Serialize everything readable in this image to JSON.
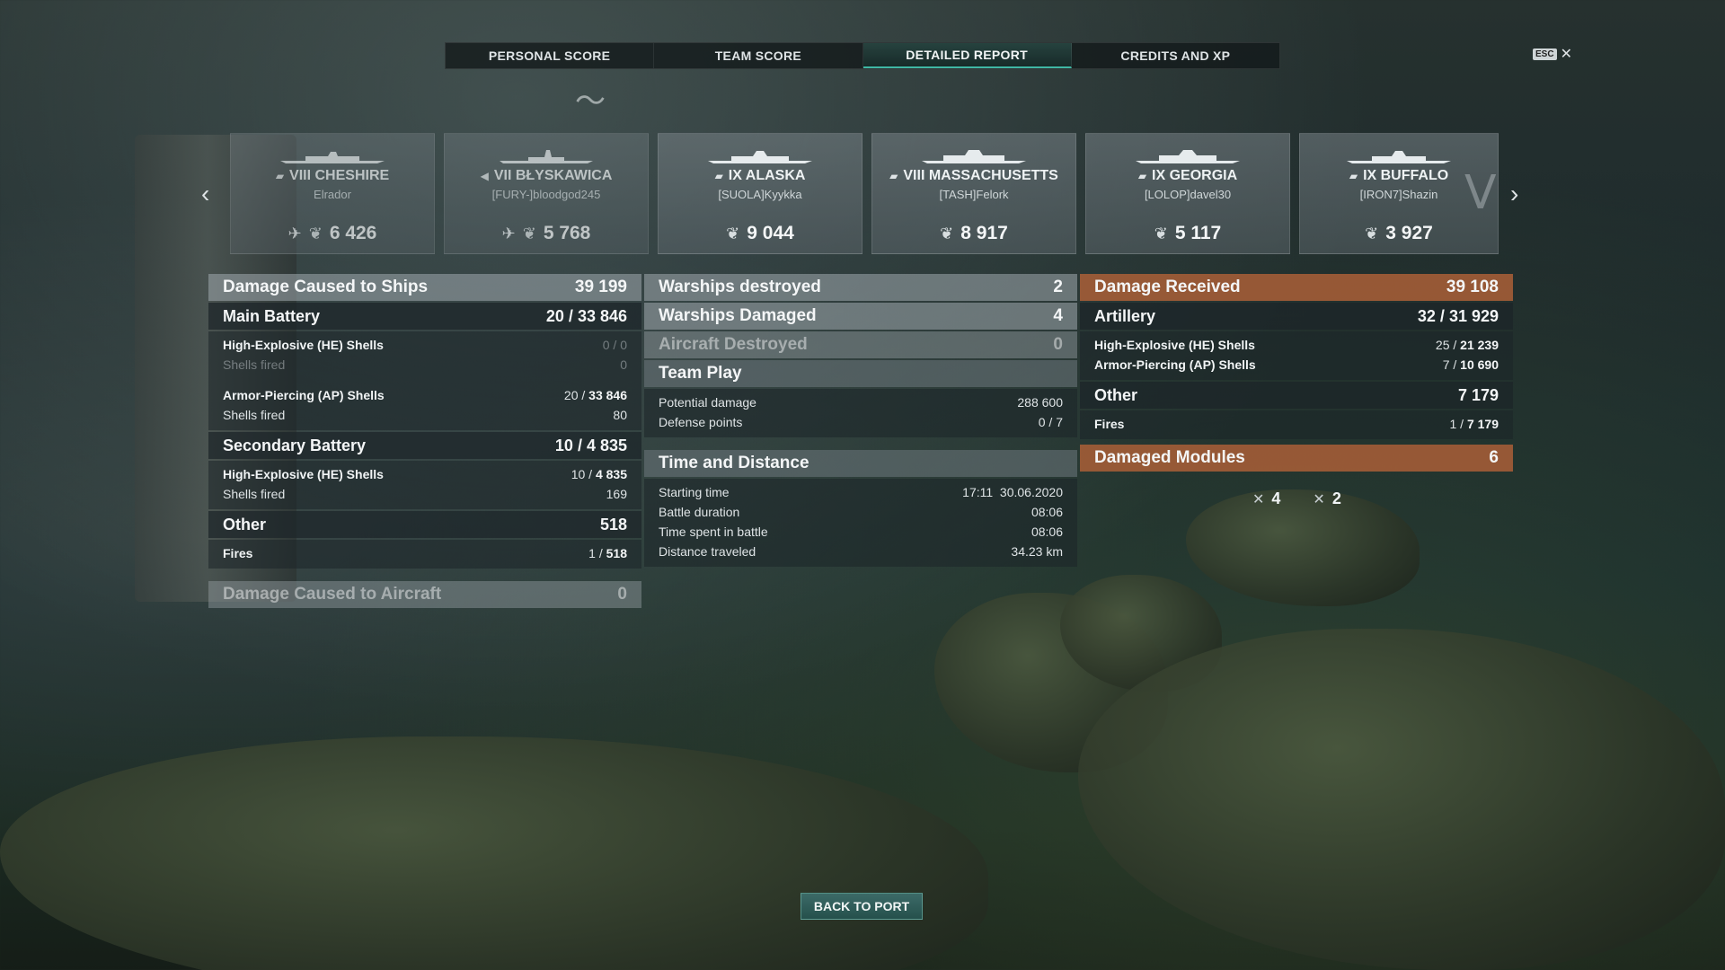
{
  "tabs": [
    {
      "label": "PERSONAL SCORE"
    },
    {
      "label": "TEAM SCORE"
    },
    {
      "label": "DETAILED REPORT"
    },
    {
      "label": "CREDITS AND XP"
    }
  ],
  "esc": {
    "key": "ESC",
    "close": "✕"
  },
  "nav": {
    "prev": "‹",
    "next": "›"
  },
  "ships": [
    {
      "tier_class": "▰",
      "name": "VIII CHESHIRE",
      "player": "Elrador",
      "score": "6 426",
      "has_plane": true
    },
    {
      "tier_class": "◀",
      "name": "VII BŁYSKAWICA",
      "player": "[FURY-]bloodgod245",
      "score": "5 768",
      "has_plane": true
    },
    {
      "tier_class": "▰",
      "name": "IX ALASKA",
      "player": "[SUOLA]Kyykka",
      "score": "9 044",
      "has_plane": false
    },
    {
      "tier_class": "▰",
      "name": "VIII MASSACHUSETTS",
      "player": "[TASH]Felork",
      "score": "8 917",
      "has_plane": false
    },
    {
      "tier_class": "▰",
      "name": "IX GEORGIA",
      "player": "[LOLOP]davel30",
      "score": "5 117",
      "has_plane": false
    },
    {
      "tier_class": "▰",
      "name": "IX BUFFALO",
      "player": "[IRON7]Shazin",
      "score": "3 927",
      "has_plane": false
    }
  ],
  "left": {
    "damage_ships": {
      "label": "Damage Caused to Ships",
      "value": "39 199"
    },
    "main_battery": {
      "label": "Main Battery",
      "value_a": "20",
      "value_b": "33 846"
    },
    "he_main": {
      "label": "High-Explosive (HE) Shells",
      "value": "0 / 0"
    },
    "he_main_fired": {
      "label": "Shells fired",
      "value": "0"
    },
    "ap_main": {
      "label": "Armor-Piercing (AP) Shells",
      "value_a": "20 / ",
      "value_b": "33 846"
    },
    "ap_main_fired": {
      "label": "Shells fired",
      "value": "80"
    },
    "secondary": {
      "label": "Secondary Battery",
      "value_a": "10",
      "value_b": "4 835"
    },
    "he_sec": {
      "label": "High-Explosive (HE) Shells",
      "value_a": "10 / ",
      "value_b": "4 835"
    },
    "he_sec_fired": {
      "label": "Shells fired",
      "value": "169"
    },
    "other": {
      "label": "Other",
      "value": "518"
    },
    "fires": {
      "label": "Fires",
      "value_a": "1 / ",
      "value_b": "518"
    },
    "damage_aircraft": {
      "label": "Damage Caused to Aircraft",
      "value": "0"
    }
  },
  "middle": {
    "destroyed": {
      "label": "Warships destroyed",
      "value": "2"
    },
    "damaged": {
      "label": "Warships Damaged",
      "value": "4"
    },
    "aircraft": {
      "label": "Aircraft Destroyed",
      "value": "0"
    },
    "team_play": {
      "label": "Team Play"
    },
    "potential": {
      "label": "Potential damage",
      "value": "288 600"
    },
    "defense": {
      "label": "Defense points",
      "value": "0 / 7"
    },
    "time_distance": {
      "label": "Time and Distance"
    },
    "start": {
      "label": "Starting time",
      "value": "17:11  30.06.2020"
    },
    "duration": {
      "label": "Battle duration",
      "value": "08:06"
    },
    "time_in_battle": {
      "label": "Time spent in battle",
      "value": "08:06"
    },
    "distance": {
      "label": "Distance traveled",
      "value": "34.23 km"
    }
  },
  "right": {
    "received": {
      "label": "Damage Received",
      "value": "39 108"
    },
    "artillery": {
      "label": "Artillery",
      "value_a": "32",
      "value_b": "31 929"
    },
    "he": {
      "label": "High-Explosive (HE) Shells",
      "value_a": "25 / ",
      "value_b": "21 239"
    },
    "ap": {
      "label": "Armor-Piercing (AP) Shells",
      "value_a": "7 / ",
      "value_b": "10 690"
    },
    "other": {
      "label": "Other",
      "value": "7 179"
    },
    "fires": {
      "label": "Fires",
      "value_a": "1 / ",
      "value_b": "7 179"
    },
    "modules": {
      "label": "Damaged Modules",
      "value": "6"
    },
    "module_items": [
      {
        "icon": "✕",
        "count": "4"
      },
      {
        "icon": "✕",
        "count": "2"
      }
    ]
  },
  "back_button": "BACK TO PORT",
  "colors": {
    "accent": "#3fb7a4",
    "received": "#aa5f37"
  }
}
